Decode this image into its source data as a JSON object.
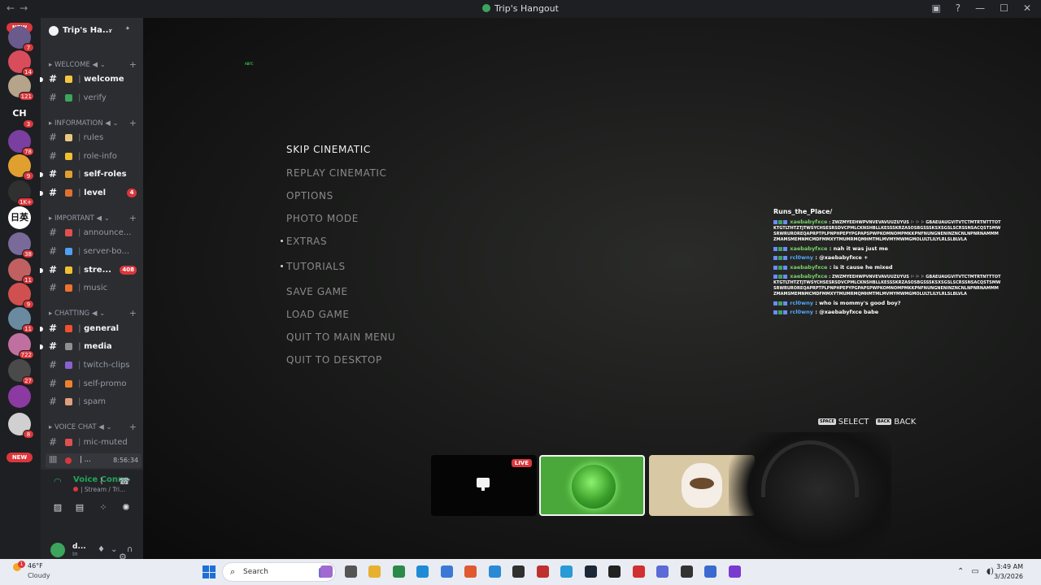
{
  "titlebar": {
    "title": "Trip's Hangout",
    "nav_back": "←",
    "nav_forward": "→",
    "icons": [
      "inbox-icon",
      "help-icon",
      "minimize-icon",
      "maximize-icon",
      "close-icon"
    ],
    "btn_minimize": "—",
    "btn_maximize": "☐",
    "btn_close": "✕"
  },
  "rail": {
    "new_top": "NEW",
    "new_bottom": "NEW",
    "servers": [
      {
        "badge": "7",
        "text": "",
        "color": "#6b5a8c"
      },
      {
        "badge": "14",
        "text": "",
        "color": "#d94c5c"
      },
      {
        "badge": "121",
        "text": "",
        "color": "#b5a48a"
      },
      {
        "badge": "3",
        "text": "CH",
        "color": "#1e1f22"
      },
      {
        "badge": "78",
        "text": "",
        "color": "#7a3fa0"
      },
      {
        "badge": "9",
        "text": "",
        "color": "#e0a030"
      },
      {
        "badge": "1K+",
        "text": "",
        "color": "#303030"
      },
      {
        "badge": "",
        "text": "日英",
        "color": "#ffffff"
      },
      {
        "badge": "38",
        "text": "",
        "color": "#7a6a9a"
      },
      {
        "badge": "11",
        "text": "",
        "color": "#c06060"
      },
      {
        "badge": "9",
        "text": "",
        "color": "#d05050"
      },
      {
        "badge": "11",
        "text": "",
        "color": "#6a8aa0"
      },
      {
        "badge": "722",
        "text": "",
        "color": "#c070a0"
      },
      {
        "badge": "27",
        "text": "",
        "color": "#4a4a4a"
      },
      {
        "badge": "",
        "text": "",
        "color": "#8a3aa0"
      },
      {
        "badge": "8",
        "text": "",
        "color": "#d0d0d0"
      }
    ]
  },
  "sidebar": {
    "server_name": "Trip's Ha...",
    "categories": [
      {
        "label": "WELCOME ◀",
        "channels": [
          {
            "name": "welcome",
            "unread": true,
            "emoji_color": "#f5c542",
            "count": ""
          },
          {
            "name": "verify",
            "unread": false,
            "emoji_color": "#3ba55c",
            "count": ""
          }
        ]
      },
      {
        "label": "INFORMATION ◀",
        "channels": [
          {
            "name": "rules",
            "unread": false,
            "emoji_color": "#e8c880",
            "count": ""
          },
          {
            "name": "role-info",
            "unread": false,
            "emoji_color": "#f0c030",
            "count": ""
          },
          {
            "name": "self-roles",
            "unread": true,
            "emoji_color": "#e0a030",
            "count": ""
          },
          {
            "name": "level",
            "unread": true,
            "emoji_color": "#e07030",
            "count": "4"
          }
        ]
      },
      {
        "label": "IMPORTANT ◀",
        "channels": [
          {
            "name": "announce...",
            "unread": false,
            "emoji_color": "#e05050",
            "count": ""
          },
          {
            "name": "server-bo...",
            "unread": false,
            "emoji_color": "#50a0f0",
            "count": ""
          },
          {
            "name": "stre...",
            "unread": true,
            "emoji_color": "#f0c030",
            "count": "408"
          },
          {
            "name": "music",
            "unread": false,
            "emoji_color": "#f07030",
            "count": ""
          }
        ]
      },
      {
        "label": "CHATTING ◀",
        "channels": [
          {
            "name": "general",
            "unread": true,
            "emoji_color": "#f05030",
            "count": ""
          },
          {
            "name": "media",
            "unread": true,
            "emoji_color": "#909090",
            "count": ""
          },
          {
            "name": "twitch-clips",
            "unread": false,
            "emoji_color": "#8a60d0",
            "count": ""
          },
          {
            "name": "self-promo",
            "unread": false,
            "emoji_color": "#f08030",
            "count": ""
          },
          {
            "name": "spam",
            "unread": false,
            "emoji_color": "#e0a080",
            "count": ""
          }
        ]
      },
      {
        "label": "VOICE CHAT ◀",
        "channels": [
          {
            "name": "mic-muted",
            "unread": false,
            "emoji_color": "#e05050",
            "count": ""
          }
        ]
      }
    ],
    "voice_row": {
      "dots": "| ...",
      "time": "8:56:34"
    },
    "voice_panel": {
      "status": "Voice Connecte",
      "sub": "| Stream / Tri..."
    },
    "user": {
      "name": "d...",
      "status": "In"
    }
  },
  "game": {
    "tiny_text": "ABFC",
    "menu": [
      {
        "label": "SKIP CINEMATIC",
        "selected": true,
        "dot": false
      },
      {
        "label": "REPLAY CINEMATIC",
        "selected": false,
        "dot": false
      },
      {
        "label": "OPTIONS",
        "selected": false,
        "dot": false
      },
      {
        "label": "PHOTO MODE",
        "selected": false,
        "dot": false
      },
      {
        "label": "EXTRAS",
        "selected": false,
        "dot": true
      },
      {
        "label": "TUTORIALS",
        "selected": false,
        "dot": true
      },
      {
        "label": "SAVE GAME",
        "selected": false,
        "dot": false
      },
      {
        "label": "LOAD GAME",
        "selected": false,
        "dot": false
      },
      {
        "label": "QUIT TO MAIN MENU",
        "selected": false,
        "dot": false
      },
      {
        "label": "QUIT TO DESKTOP",
        "selected": false,
        "dot": false
      }
    ],
    "hints": {
      "select_key": "SPACE",
      "select_label": "SELECT",
      "back_key": "BACK",
      "back_label": "BACK"
    },
    "chat": {
      "title": "Runs_the_Place/",
      "messages": [
        {
          "user": "xaebabyfxce",
          "user_class": "u1",
          "text": ": ZWZMYEEHWPVNVEVAVUUZUYUS ⚐ ⚐ ⚐ GBAEUAUGVITVTCTMTRTNTTTOTKTGTLTHTZTJTWSYCHSESRSDVCPMLCKNSHBLLKESSSKRZASOSBGSSSKSXSGSLSCRSSNSACQSTSMWSRWRUROREQAPRPTPLPNPHPEPYPGPAPSPWPKOMNOMPMKKPNFNUNGNENINZNCNLNPNRNAMMMZMAMSMEMNMCMDFMMXYTMUMRMQMHMTMLMVMYMWMGMOLULTLILYLRLSLBLVLA",
          "long": true
        },
        {
          "user": "xaebabyfxce",
          "user_class": "u1",
          "text": ": nah it was just me",
          "long": false
        },
        {
          "user": "rcl0wny",
          "user_class": "u2",
          "text": ": @xaebabyfxce +",
          "long": false
        },
        {
          "user": "xaebabyfxce",
          "user_class": "u1",
          "text": ": is it cause he mixed",
          "long": false
        },
        {
          "user": "xaebabyfxce",
          "user_class": "u1",
          "text": ": ZWZMYEEHWPVNVEVAVUUZUYUS ⚐ ⚐ ⚐ GBAEUAUGVITVTCTMTRTNTTTOTKTGTLTHTZTJTWSYCHSESRSDVCPMLCKNSHBLLKESSSKRZASOSBGSSSKSXSGSLSCRSSNSACQSTSMWSRWRUROREQAPRPTPLPNPHPEPYPGPAPSPWPKOMNOMPMKKPNFNUNGNENINZNCNLNPNRNAMMMZMAMSMEMNMCMDFMMXYTMUMRMQMHMTMLMVMYMWMGMOLULTLILYLRLSLBLVLA",
          "long": true
        },
        {
          "user": "rcl0wny",
          "user_class": "u2",
          "text": ": who is mommy's good boy?",
          "long": false
        },
        {
          "user": "rcl0wny",
          "user_class": "u2",
          "text": ": @xaebabyfxce babe",
          "long": false
        }
      ]
    },
    "stream_tiles": {
      "live_label": "LIVE"
    }
  },
  "taskbar": {
    "weather_badge": "1",
    "temp": "46°F",
    "condition": "Cloudy",
    "search_placeholder": "Search",
    "app_colors": [
      "#a06ad0",
      "#555",
      "#e8b030",
      "#2a8a4a",
      "#1f8ad6",
      "#3a7ad6",
      "#e05a30",
      "#2a8ad6",
      "#303030",
      "#c03030",
      "#2a9ad6",
      "#1b2838",
      "#222",
      "#d03030",
      "#5a6ad6",
      "#333",
      "#3a6ad0",
      "#7a3ad0"
    ],
    "tray": [
      "⌃",
      "▭",
      "◖)"
    ],
    "time": "3:49 AM",
    "date": "3/3/2026"
  }
}
